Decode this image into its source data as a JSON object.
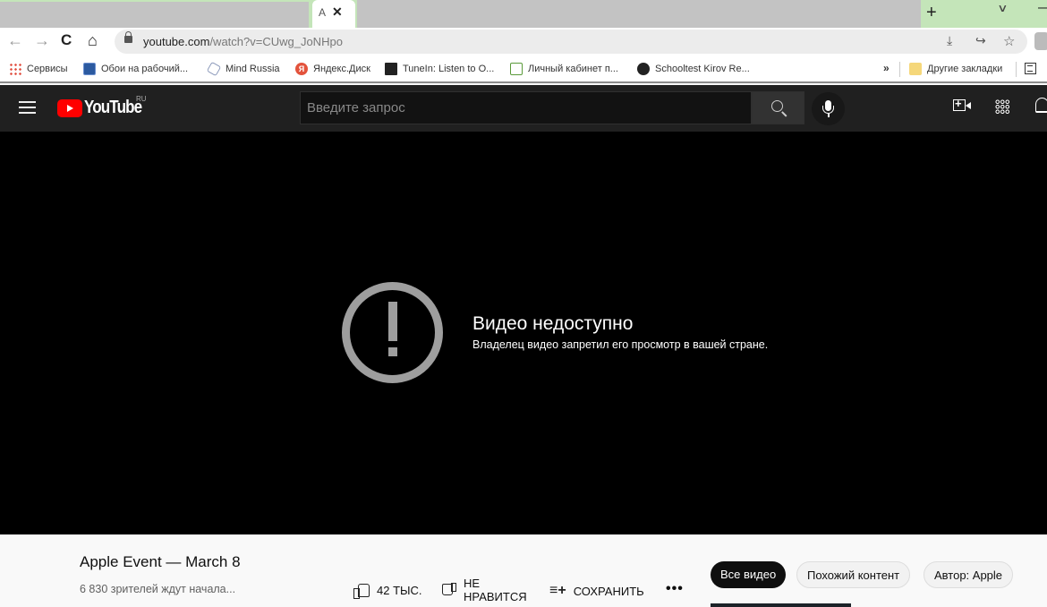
{
  "browser": {
    "active_tab_title": "A",
    "new_tab_label": "+",
    "tab_search_label": "∨",
    "minimize_label": "—",
    "nav": {
      "back": "←",
      "forward": "→",
      "reload": "C",
      "home": "⌂"
    },
    "url": {
      "host": "youtube.com",
      "path": "/watch?v=CUwg_JoNHpo"
    },
    "omnibox_icons": {
      "install": "⤓",
      "share": "↪",
      "star": "☆"
    },
    "bookmarks": [
      {
        "label": "Сервисы",
        "icon": "apps-grid-icon"
      },
      {
        "label": "Обои на рабочий...",
        "icon": "monitor-icon"
      },
      {
        "label": "Mind Russia",
        "icon": "hexagon-icon"
      },
      {
        "label": "Яндекс.Диск",
        "icon": "yandex-icon",
        "glyph": "Я"
      },
      {
        "label": "TuneIn: Listen to O...",
        "icon": "tunein-icon"
      },
      {
        "label": "Личный кабинет п...",
        "icon": "folder-play-icon"
      },
      {
        "label": "Schooltest Kirov Re...",
        "icon": "globe-icon"
      }
    ],
    "bookmarks_overflow": "»",
    "other_bookmarks": "Другие закладки"
  },
  "youtube": {
    "logo_text": "YouTube",
    "region": "RU",
    "search_placeholder": "Введите запрос",
    "search_value": ""
  },
  "player": {
    "error_title": "Видео недоступно",
    "error_message": "Владелец видео запретил его просмотр в вашей стране."
  },
  "video": {
    "title": "Apple Event — March 8",
    "viewers": "6 830 зрителей ждут начала...",
    "likes": "42 ТЫС.",
    "dislike_label_1": "НЕ",
    "dislike_label_2": "НРАВИТСЯ",
    "save_icon": "≡+",
    "save_label": "СОХРАНИТЬ",
    "more_label": "•••"
  },
  "chips": [
    {
      "label": "Все видео",
      "selected": true
    },
    {
      "label": "Похожий контент",
      "selected": false
    },
    {
      "label": "Автор: Apple",
      "selected": false
    }
  ]
}
